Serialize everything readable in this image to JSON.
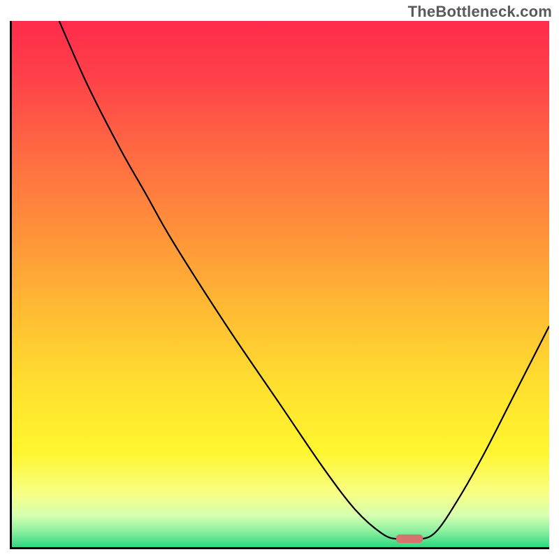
{
  "watermark": "TheBottleneck.com",
  "chart_data": {
    "type": "line",
    "title": "",
    "xlabel": "",
    "ylabel": "",
    "xlim": [
      0,
      100
    ],
    "ylim": [
      0,
      100
    ],
    "background_gradient": {
      "stops": [
        {
          "offset": 0.0,
          "color": "#ff2b4b"
        },
        {
          "offset": 0.1,
          "color": "#ff3f4a"
        },
        {
          "offset": 0.25,
          "color": "#ff6a42"
        },
        {
          "offset": 0.4,
          "color": "#ff913a"
        },
        {
          "offset": 0.55,
          "color": "#ffbb33"
        },
        {
          "offset": 0.7,
          "color": "#ffe12e"
        },
        {
          "offset": 0.82,
          "color": "#fff62f"
        },
        {
          "offset": 0.9,
          "color": "#f7ff87"
        },
        {
          "offset": 0.94,
          "color": "#d6ffb0"
        },
        {
          "offset": 0.97,
          "color": "#8bf0a0"
        },
        {
          "offset": 1.0,
          "color": "#2ed880"
        }
      ]
    },
    "series": [
      {
        "name": "bottleneck-curve",
        "type": "line",
        "color": "#000000",
        "width": 2.2,
        "points": [
          {
            "x": 8.8,
            "y": 100.0
          },
          {
            "x": 14.0,
            "y": 88.0
          },
          {
            "x": 20.0,
            "y": 76.0
          },
          {
            "x": 25.0,
            "y": 67.0
          },
          {
            "x": 30.0,
            "y": 58.0
          },
          {
            "x": 40.0,
            "y": 42.0
          },
          {
            "x": 50.0,
            "y": 27.0
          },
          {
            "x": 58.0,
            "y": 15.0
          },
          {
            "x": 64.0,
            "y": 7.0
          },
          {
            "x": 69.0,
            "y": 2.5
          },
          {
            "x": 72.0,
            "y": 1.5
          },
          {
            "x": 76.0,
            "y": 1.5
          },
          {
            "x": 79.0,
            "y": 3.0
          },
          {
            "x": 83.0,
            "y": 9.0
          },
          {
            "x": 88.0,
            "y": 18.0
          },
          {
            "x": 94.0,
            "y": 30.0
          },
          {
            "x": 100.0,
            "y": 42.0
          }
        ]
      }
    ],
    "marker": {
      "name": "sweet-spot-marker",
      "x_center": 74.0,
      "y": 1.6,
      "width": 5.0,
      "height": 1.6,
      "color": "#d6736f"
    }
  }
}
